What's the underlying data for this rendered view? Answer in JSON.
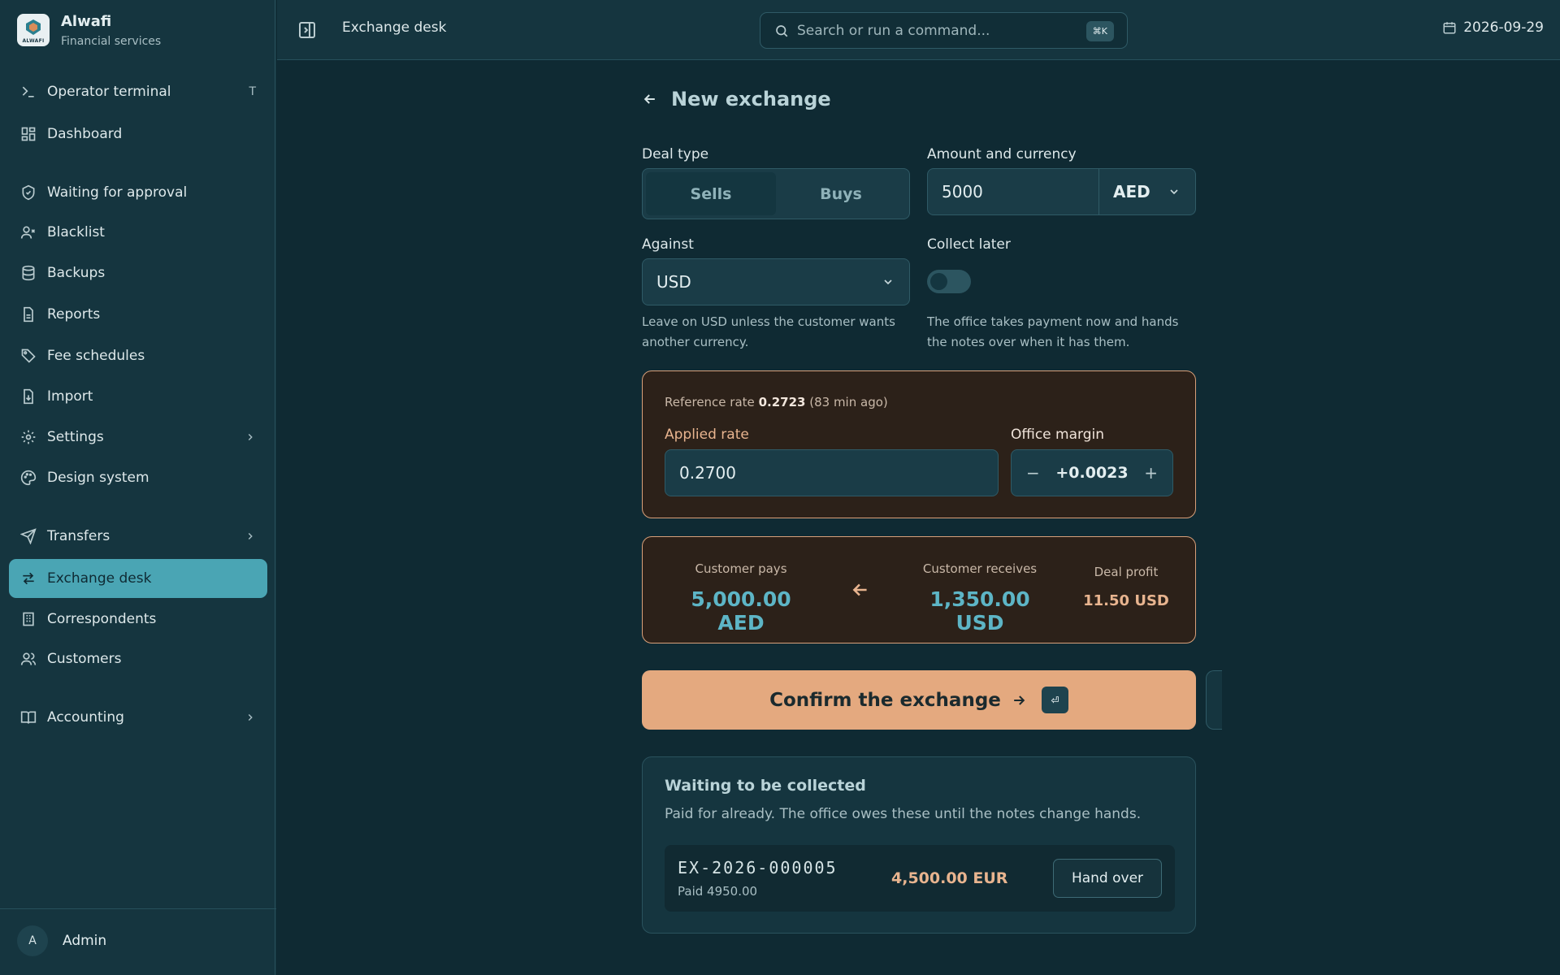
{
  "brand": {
    "name": "Alwafi",
    "subtitle": "Financial services",
    "logo_word": "ALWAFI"
  },
  "sidebar": {
    "items": [
      {
        "label": "Operator terminal",
        "shortcut": "T",
        "icon": "terminal-icon"
      },
      {
        "label": "Dashboard",
        "icon": "dashboard-icon"
      },
      {
        "label": "Waiting for approval",
        "icon": "shield-icon"
      },
      {
        "label": "Blacklist",
        "icon": "user-x-icon"
      },
      {
        "label": "Backups",
        "icon": "database-icon"
      },
      {
        "label": "Reports",
        "icon": "file-text-icon"
      },
      {
        "label": "Fee schedules",
        "icon": "tag-icon"
      },
      {
        "label": "Import",
        "icon": "file-import-icon"
      },
      {
        "label": "Settings",
        "icon": "gear-icon"
      },
      {
        "label": "Design system",
        "icon": "palette-icon"
      },
      {
        "label": "Transfers",
        "icon": "send-icon"
      },
      {
        "label": "Exchange desk",
        "icon": "exchange-icon"
      },
      {
        "label": "Correspondents",
        "icon": "building-icon"
      },
      {
        "label": "Customers",
        "icon": "users-icon"
      },
      {
        "label": "Accounting",
        "icon": "book-icon"
      }
    ],
    "user": {
      "initial": "A",
      "name": "Admin"
    }
  },
  "topbar": {
    "breadcrumb": "Exchange desk",
    "search_placeholder": "Search or run a command...",
    "search_shortcut": "⌘K",
    "date": "2026-09-29"
  },
  "form": {
    "title": "New exchange",
    "deal_type_label": "Deal type",
    "deal_options": [
      "Sells",
      "Buys"
    ],
    "deal_selected": "Sells",
    "amount_label": "Amount and currency",
    "amount_value": "5000",
    "amount_currency": "AED",
    "against_label": "Against",
    "against_value": "USD",
    "against_help": "Leave on USD unless the customer wants another currency.",
    "collect_later_label": "Collect later",
    "collect_later_on": false,
    "collect_help": "The office takes payment now and hands the notes over when it has them."
  },
  "rate": {
    "ref_prefix": "Reference rate",
    "ref_value": "0.2723",
    "ref_age": "(83 min ago)",
    "applied_label": "Applied rate",
    "applied_value": "0.2700",
    "margin_label": "Office margin",
    "margin_value": "+0.0023",
    "minus": "−",
    "plus": "+"
  },
  "summary": {
    "pays_label": "Customer pays",
    "pays_value": "5,000.00 AED",
    "receives_label": "Customer receives",
    "receives_value": "1,350.00 USD",
    "profit_label": "Deal profit",
    "profit_value": "11.50 USD"
  },
  "confirm": {
    "label": "Confirm the exchange",
    "enter_key": "⏎"
  },
  "waiting": {
    "title": "Waiting to be collected",
    "subtitle": "Paid for already. The office owes these until the notes change hands.",
    "rows": [
      {
        "id": "EX-2026-000005",
        "paid": "Paid 4950.00",
        "amount": "4,500.00 EUR",
        "action": "Hand over"
      }
    ]
  },
  "colors": {
    "accent": "#4aa5b4",
    "warm": "#e4a97f",
    "card_border": "#d8a07a",
    "value_teal": "#5db5c6"
  }
}
